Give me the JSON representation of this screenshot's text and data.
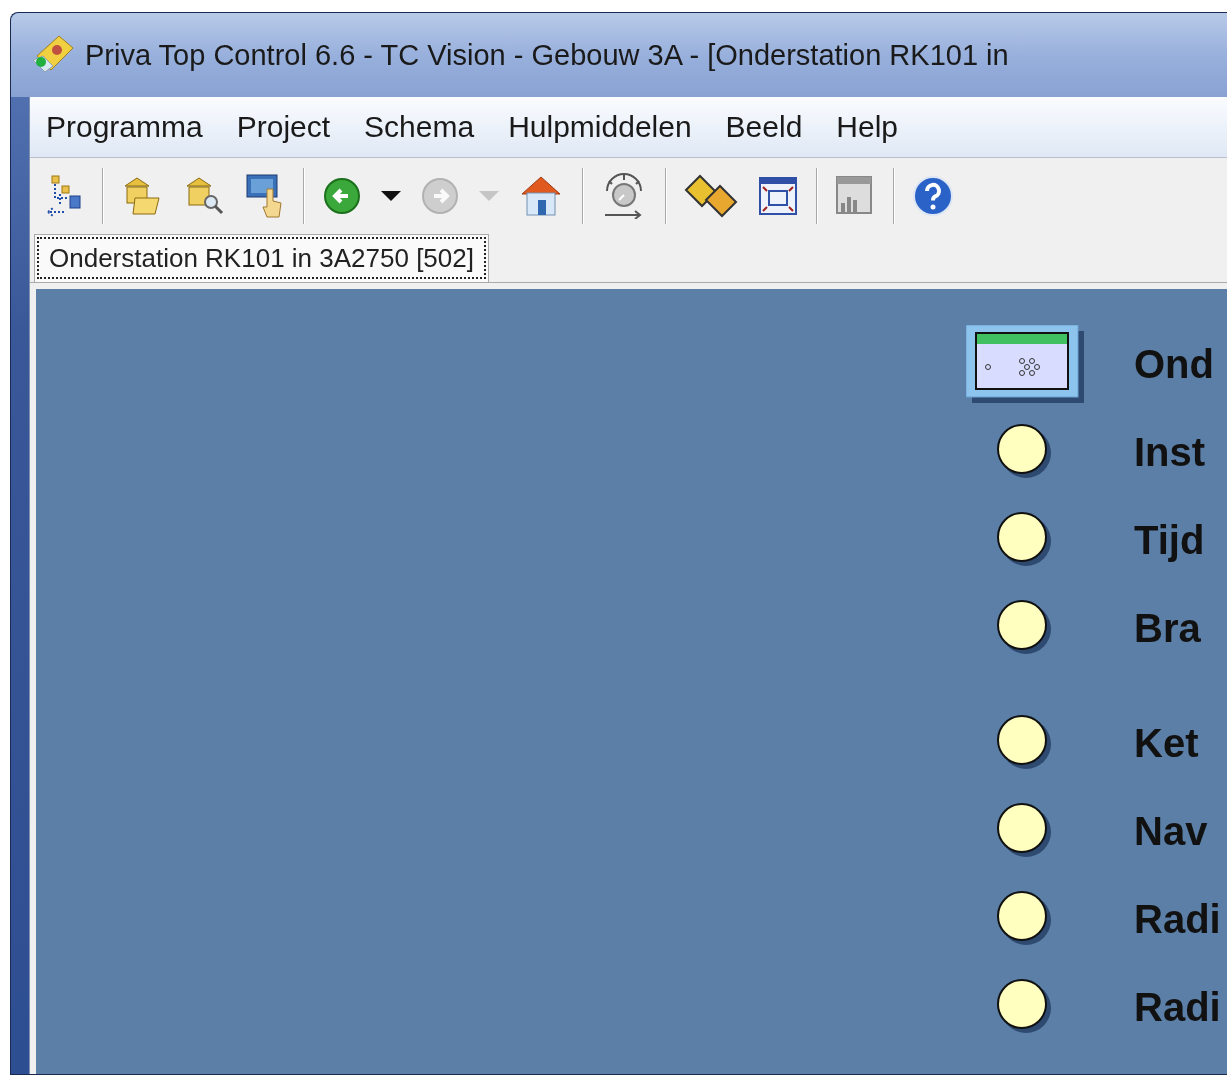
{
  "window": {
    "title": "Priva Top Control 6.6 - TC Vision - Gebouw 3A - [Onderstation RK101 in"
  },
  "menu": [
    "Programma",
    "Project",
    "Schema",
    "Hulpmiddelen",
    "Beeld",
    "Help"
  ],
  "toolbar": [
    {
      "kind": "tree",
      "disabled": false
    },
    {
      "kind": "sep"
    },
    {
      "kind": "open",
      "disabled": false
    },
    {
      "kind": "search",
      "disabled": false
    },
    {
      "kind": "touch",
      "disabled": false
    },
    {
      "kind": "sep"
    },
    {
      "kind": "back",
      "disabled": false
    },
    {
      "kind": "caret",
      "disabled": false
    },
    {
      "kind": "forward",
      "disabled": true
    },
    {
      "kind": "caret",
      "disabled": true
    },
    {
      "kind": "home",
      "disabled": false
    },
    {
      "kind": "sep"
    },
    {
      "kind": "gauge",
      "disabled": false
    },
    {
      "kind": "sep"
    },
    {
      "kind": "film",
      "disabled": false
    },
    {
      "kind": "frame",
      "disabled": false
    },
    {
      "kind": "sep"
    },
    {
      "kind": "report",
      "disabled": false
    },
    {
      "kind": "sep"
    },
    {
      "kind": "help",
      "disabled": false
    }
  ],
  "tabs": [
    {
      "label": "Onderstation RK101 in 3A2750 [502]",
      "selected": true
    }
  ],
  "canvas": {
    "groups": [
      [
        {
          "kind": "screen",
          "label": "Ond"
        },
        {
          "kind": "point",
          "label": "Inst"
        },
        {
          "kind": "point",
          "label": "Tijd"
        },
        {
          "kind": "point",
          "label": "Bra"
        }
      ],
      [
        {
          "kind": "point",
          "label": "Ket"
        },
        {
          "kind": "point",
          "label": "Nav"
        },
        {
          "kind": "point",
          "label": "Radi"
        },
        {
          "kind": "point",
          "label": "Radi"
        }
      ]
    ]
  }
}
